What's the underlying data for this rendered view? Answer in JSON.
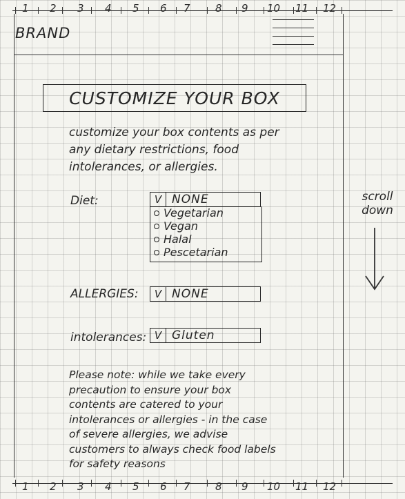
{
  "ruler": {
    "numbers": [
      "1",
      "2",
      "3",
      "4",
      "5",
      "6",
      "7",
      "8",
      "9",
      "10",
      "11",
      "12"
    ]
  },
  "header": {
    "brand": "BRAND",
    "menu_icon": "hamburger-menu-icon"
  },
  "title": "CUSTOMIZE YOUR BOX",
  "intro": "customize your box contents as per any dietary restrictions, food intolerances, or allergies.",
  "diet": {
    "label": "Diet:",
    "selected": "NONE",
    "check_mark": "V",
    "options": [
      "Vegetarian",
      "Vegan",
      "Halal",
      "Pescetarian"
    ]
  },
  "allergies": {
    "label": "ALLERGIES:",
    "selected": "NONE",
    "check_mark": "V"
  },
  "intolerances": {
    "label": "intolerances:",
    "selected": "Gluten",
    "check_mark": "V"
  },
  "note": "Please note: while we take every precaution to ensure your box contents are catered to your intolerances or allergies - in the case of severe allergies, we advise customers to always check food labels for safety reasons",
  "scroll_hint": {
    "text": "scroll down",
    "icon": "arrow-down-icon"
  }
}
